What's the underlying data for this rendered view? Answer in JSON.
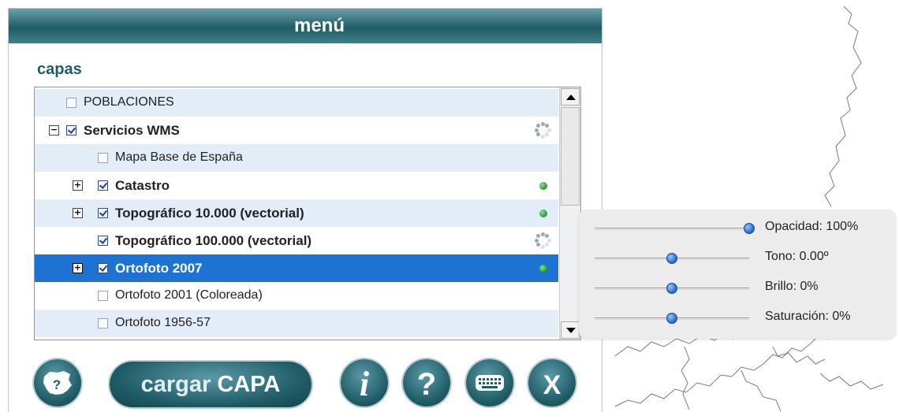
{
  "colors": {
    "title_bar": "#1f5c66",
    "selected_row": "#1e73d2",
    "alt_row": "#e3edf8",
    "status_ok": "#1f9a2a"
  },
  "menu": {
    "title": "menú",
    "section_title": "capas"
  },
  "layers": [
    {
      "label": "POBLACIONES",
      "checked": false,
      "bold": false,
      "expander": "none",
      "status": "none",
      "selected": false
    },
    {
      "label": "Servicios WMS",
      "checked": true,
      "bold": true,
      "expander": "collapse",
      "status": "loading",
      "selected": false
    },
    {
      "label": "Mapa Base de España",
      "checked": false,
      "bold": false,
      "expander": "none",
      "status": "none",
      "selected": false
    },
    {
      "label": "Catastro",
      "checked": true,
      "bold": true,
      "expander": "expand",
      "status": "ok",
      "selected": false
    },
    {
      "label": "Topográfico 10.000 (vectorial)",
      "checked": true,
      "bold": true,
      "expander": "expand",
      "status": "ok",
      "selected": false
    },
    {
      "label": "Topográfico 100.000 (vectorial)",
      "checked": true,
      "bold": true,
      "expander": "none",
      "status": "loading",
      "selected": false
    },
    {
      "label": "Ortofoto 2007",
      "checked": true,
      "bold": true,
      "expander": "expand",
      "status": "ok",
      "selected": true
    },
    {
      "label": "Ortofoto 2001 (Coloreada)",
      "checked": false,
      "bold": false,
      "expander": "none",
      "status": "none",
      "selected": false
    },
    {
      "label": "Ortofoto 1956-57",
      "checked": false,
      "bold": false,
      "expander": "none",
      "status": "none",
      "selected": false
    }
  ],
  "adjustments": [
    {
      "label": "Opacidad: 100%",
      "level": 1.0
    },
    {
      "label": "Tono: 0.00º",
      "level": 0.5
    },
    {
      "label": "Brillo: 0%",
      "level": 0.5
    },
    {
      "label": "Saturación: 0%",
      "level": 0.5
    }
  ],
  "buttons": {
    "load_layer": {
      "word1": "cargar",
      "word2": "CAPA"
    },
    "help_glyph": "?",
    "info_glyph": "i",
    "close_glyph": "X",
    "map_help_glyph": "?"
  },
  "icons": {
    "map_help": "spain-map-help-icon",
    "info": "info-icon",
    "help": "help-icon",
    "keyboard": "keyboard-icon",
    "close": "close-icon",
    "loading": "loading-spinner-icon",
    "status": "status-dot-icon"
  }
}
